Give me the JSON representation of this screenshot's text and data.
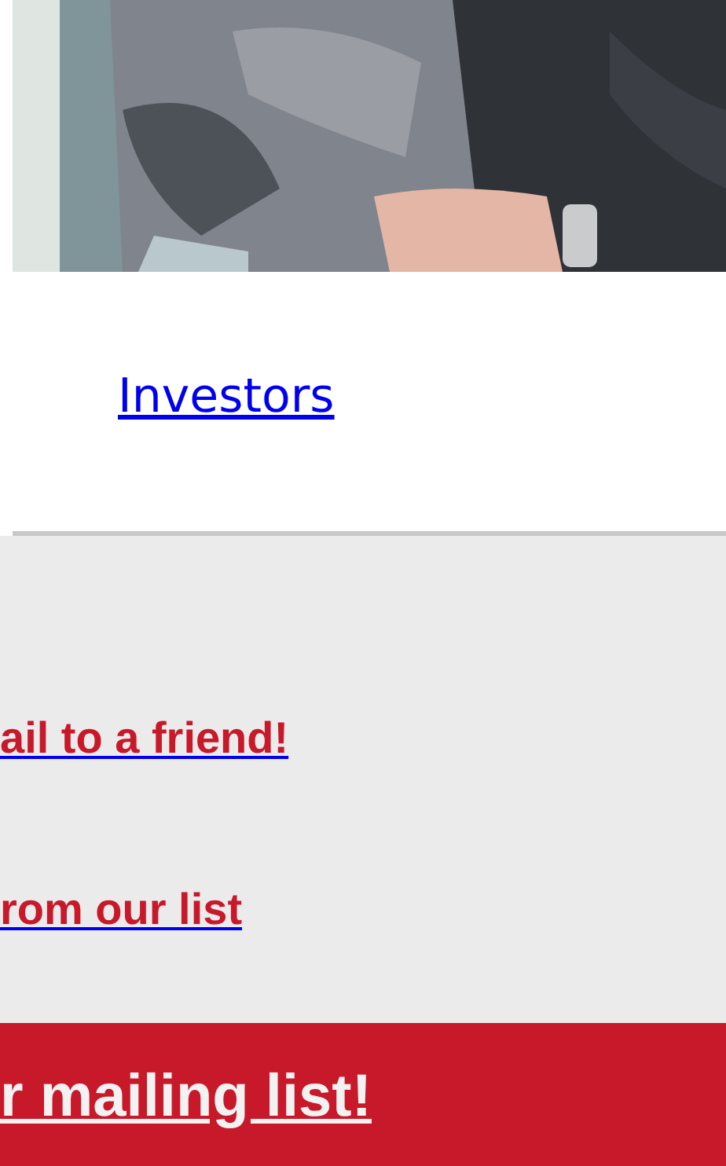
{
  "investors_link": "Investors",
  "links": [
    {
      "text": "ail to a friend!"
    },
    {
      "text": "rom our list"
    }
  ],
  "mailing_banner": {
    "text": "r mailing list!"
  }
}
